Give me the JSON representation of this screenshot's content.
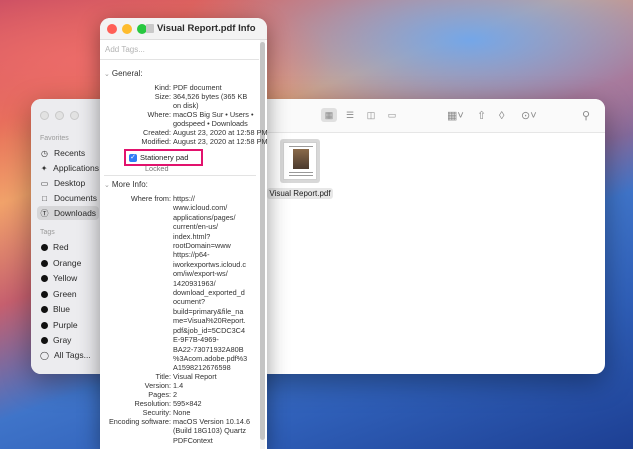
{
  "colors": {
    "close": "#ff5f57",
    "minimize": "#febc2e",
    "zoom": "#28c840",
    "highlight": "#e2126d",
    "checkbox": "#2f7cf6"
  },
  "finder": {
    "sidebar": {
      "favorites_heading": "Favorites",
      "favorites": [
        {
          "label": "Recents",
          "icon": "clock-icon"
        },
        {
          "label": "Applications",
          "icon": "applications-icon"
        },
        {
          "label": "Desktop",
          "icon": "desktop-icon"
        },
        {
          "label": "Documents",
          "icon": "document-icon"
        },
        {
          "label": "Downloads",
          "icon": "download-icon",
          "selected": true
        }
      ],
      "tags_heading": "Tags",
      "tags": [
        {
          "label": "Red"
        },
        {
          "label": "Orange"
        },
        {
          "label": "Yellow"
        },
        {
          "label": "Green"
        },
        {
          "label": "Blue"
        },
        {
          "label": "Purple"
        },
        {
          "label": "Gray"
        }
      ],
      "all_tags": "All Tags..."
    },
    "file": {
      "name": "Visual Report.pdf"
    }
  },
  "info": {
    "title": "Visual Report.pdf Info",
    "tags_placeholder": "Add Tags...",
    "general": {
      "heading": "General:",
      "kind_label": "Kind:",
      "kind": "PDF document",
      "size_label": "Size:",
      "size": "364,526 bytes (365 KB\non disk)",
      "where_label": "Where:",
      "where": "macOS Big Sur • Users •\ngodspeed • Downloads",
      "created_label": "Created:",
      "created": "August 23, 2020 at 12:58 PM",
      "modified_label": "Modified:",
      "modified": "August 23, 2020 at 12:58 PM",
      "stationery_label": "Stationery pad",
      "locked_label": "Locked"
    },
    "more_info": {
      "heading": "More Info:",
      "where_from_label": "Where from:",
      "where_from": "https://\nwww.icloud.com/\napplications/pages/\ncurrent/en-us/\nindex.html?\nrootDomain=www\nhttps://p64-\niworkexportws.icloud.c\nom/iw/export-ws/\n1420931963/\ndownload_exported_d\nocument?\nbuild=primary&file_na\nme=Visual%20Report.\npdf&job_id=5CDC3C4\nE-9F7B-4969-\nBA22-73071932A80B\n%3Acom.adobe.pdf%3\nA1598212676598",
      "title_label": "Title:",
      "title": "Visual Report",
      "version_label": "Version:",
      "version": "1.4",
      "pages_label": "Pages:",
      "pages": "2",
      "resolution_label": "Resolution:",
      "resolution": "595×842",
      "security_label": "Security:",
      "security": "None",
      "encoding_label": "Encoding software:",
      "encoding": "macOS Version 10.14.6\n(Build 18G103) Quartz\nPDFContext"
    }
  }
}
